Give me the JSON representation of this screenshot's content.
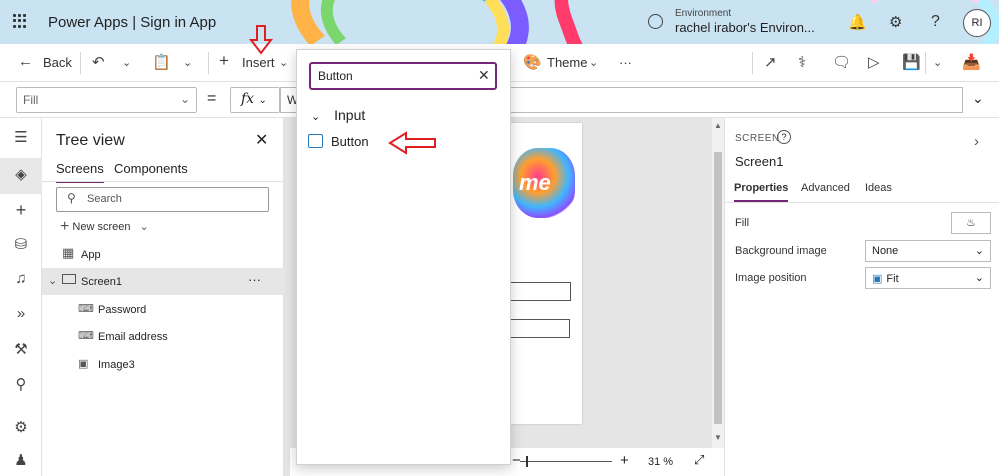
{
  "header": {
    "app_title": "Power Apps  |  Sign in App",
    "environment_label": "Environment",
    "environment_name": "rachel irabor's Environ...",
    "avatar_initials": "RI"
  },
  "commandbar": {
    "back_label": "Back",
    "insert_label": "Insert",
    "theme_label": "Theme",
    "more_label": "···"
  },
  "formulabar": {
    "property": "Fill",
    "equals": "=",
    "fx": "fx",
    "formula": "Wh"
  },
  "treeview": {
    "title": "Tree view",
    "tabs": [
      "Screens",
      "Components"
    ],
    "search_placeholder": "Search",
    "new_screen_label": "New screen",
    "items": [
      {
        "label": "App"
      },
      {
        "label": "Screen1"
      },
      {
        "label": "Password"
      },
      {
        "label": "Email address"
      },
      {
        "label": "Image3"
      }
    ],
    "more": "···"
  },
  "insert_panel": {
    "search_value": "Button",
    "group_label": "Input",
    "result_item": "Button"
  },
  "canvas": {
    "logo_text": "me",
    "zoom_value": "31  %"
  },
  "properties": {
    "caption": "SCREEN",
    "help": "?",
    "screen_name": "Screen1",
    "tabs": [
      "Properties",
      "Advanced",
      "Ideas"
    ],
    "fill_label": "Fill",
    "bg_image_label": "Background image",
    "bg_image_value": "None",
    "img_position_label": "Image position",
    "img_position_value": "Fit"
  },
  "colors": {
    "accent": "#742774",
    "annotation_red": "#e02020",
    "header_bg": "#c9e3f3"
  }
}
